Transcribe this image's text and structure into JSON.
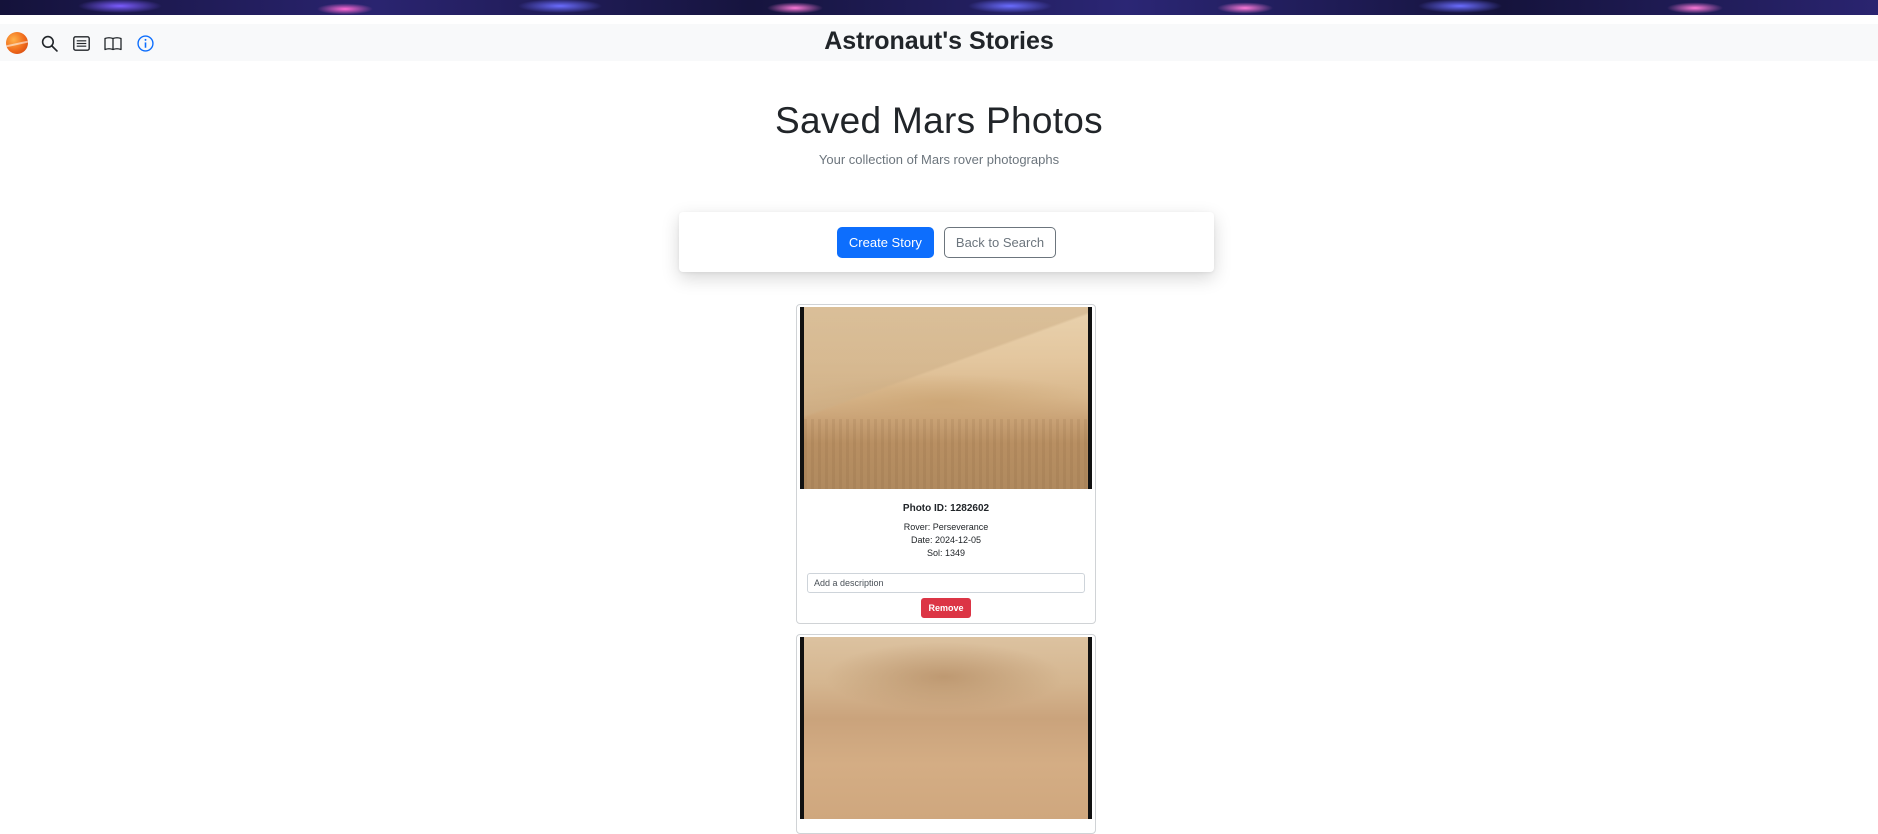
{
  "navbar": {
    "title": "Astronaut's Stories",
    "icons": [
      "mars-logo-icon",
      "search-icon",
      "list-icon",
      "book-icon",
      "info-icon"
    ]
  },
  "header": {
    "title": "Saved Mars Photos",
    "subtitle": "Your collection of Mars rover photographs"
  },
  "actions": {
    "create_story": "Create Story",
    "back_to_search": "Back to Search"
  },
  "photos": [
    {
      "id_label": "Photo ID: 1282602",
      "rover": "Rover: Perseverance",
      "date": "Date: 2024-12-05",
      "sol": "Sol: 1349",
      "description_placeholder": "Add a description",
      "remove_label": "Remove"
    }
  ],
  "colors": {
    "primary": "#0d6efd",
    "danger": "#dc3545",
    "secondary": "#6c757d",
    "navbar_bg": "#f8f9fa",
    "info_icon": "#0d6efd"
  }
}
